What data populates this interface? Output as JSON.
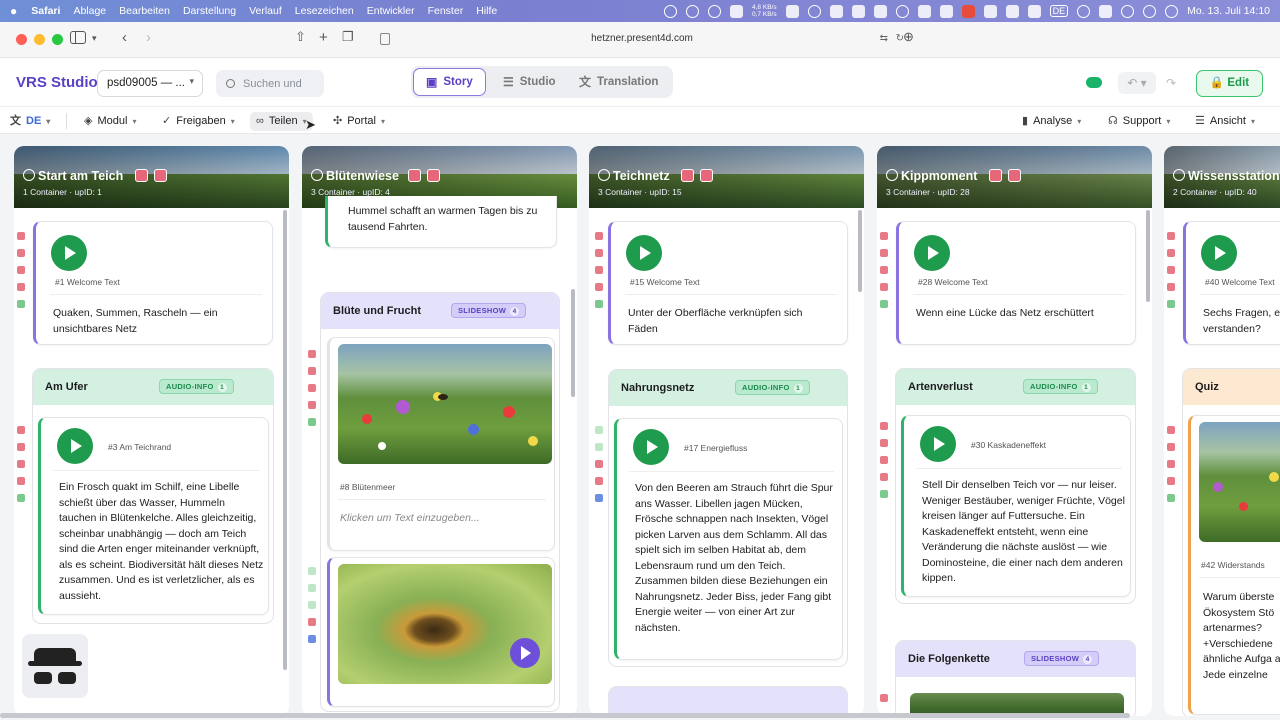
{
  "menubar": {
    "items": [
      "Safari",
      "Ablage",
      "Bearbeiten",
      "Darstellung",
      "Verlauf",
      "Lesezeichen",
      "Entwickler",
      "Fenster",
      "Hilfe"
    ],
    "net_up": "4,8 KB/s",
    "net_down": "0,7 KB/s",
    "lang": "DE",
    "datetime": "Mo. 13. Juli 14:10"
  },
  "browser": {
    "url": "hetzner.present4d.com"
  },
  "app": {
    "brand": "VRS Studio",
    "project": "psd09005 — ...",
    "search_placeholder": "Suchen und",
    "modes": [
      {
        "label": "Story",
        "icon": "map-icon"
      },
      {
        "label": "Studio",
        "icon": "sliders-icon"
      },
      {
        "label": "Translation",
        "icon": "translate-icon"
      }
    ],
    "edit": "Edit"
  },
  "toolbar": {
    "lang": "DE",
    "modul": "Modul",
    "freigaben": "Freigaben",
    "teilen": "Teilen",
    "portal": "Portal",
    "analyse": "Analyse",
    "support": "Support",
    "ansicht": "Ansicht"
  },
  "columns": [
    {
      "title": "Start am Teich",
      "sub": "1 Container · upID: 1",
      "welcome": {
        "meta": "#1  Welcome Text",
        "text": "Quaken, Summen, Rascheln — ein unsichtbares Netz"
      },
      "group": {
        "title": "Am Ufer",
        "badge": "AUDIO-INFO",
        "count": "1",
        "card": {
          "meta": "#3  Am Teichrand",
          "text": "Ein Frosch quakt im Schilf, eine Libelle schießt über das Wasser, Hummeln tauchen in Blütenkelche. Alles gleichzeitig, scheinbar unabhängig — doch am Teich sind die Arten enger miteinander verknüpft, als es scheint. Biodiversität hält dieses Netz zusammen. Und es ist verletzlicher, als es aussieht."
        }
      }
    },
    {
      "title": "Blütenwiese",
      "sub": "3 Container · upID: 4",
      "top_text": "Hummel schafft an warmen Tagen bis zu tausend Fahrten.",
      "group": {
        "title": "Blüte und Frucht",
        "badge": "SLIDESHOW",
        "count": "4",
        "card": {
          "meta": "#8  Blütenmeer",
          "placeholder": "Klicken um Text einzugeben..."
        }
      }
    },
    {
      "title": "Teichnetz",
      "sub": "3 Container · upID: 15",
      "welcome": {
        "meta": "#15  Welcome Text",
        "text": "Unter der Oberfläche verknüpfen sich Fäden"
      },
      "group": {
        "title": "Nahrungsnetz",
        "badge": "AUDIO-INFO",
        "count": "1",
        "card": {
          "meta": "#17  Energiefluss",
          "text": "Von den Beeren am Strauch führt die Spur ans Wasser. Libellen jagen Mücken, Frösche schnappen nach Insekten, Vögel picken Larven aus dem Schlamm. All das spielt sich im selben Habitat ab, dem Lebensraum rund um den Teich. Zusammen bilden diese Beziehungen ein Nahrungsnetz. Jeder Biss, jeder Fang gibt Energie weiter — von einer Art zur nächsten."
        }
      }
    },
    {
      "title": "Kippmoment",
      "sub": "3 Container · upID: 28",
      "welcome": {
        "meta": "#28  Welcome Text",
        "text": "Wenn eine Lücke das Netz erschüttert"
      },
      "group": {
        "title": "Artenverlust",
        "badge": "AUDIO-INFO",
        "count": "1",
        "card": {
          "meta": "#30  Kaskadeneffekt",
          "text": "Stell Dir denselben Teich vor — nur leiser. Weniger Bestäuber, weniger Früchte, Vögel kreisen länger auf Futtersuche. Ein Kaskadeneffekt entsteht, wenn eine Veränderung die nächste auslöst — wie Dominosteine, die einer nach dem anderen kippen."
        }
      },
      "group2": {
        "title": "Die Folgenkette",
        "badge": "SLIDESHOW",
        "count": "4"
      }
    },
    {
      "title": "Wissensstation",
      "sub": "2 Container · upID: 40",
      "welcome": {
        "meta": "#40  Welcome Text",
        "text": "Sechs Fragen, e verstanden?"
      },
      "group": {
        "title": "Quiz",
        "card": {
          "meta": "#42  Widerstands",
          "text": "Warum überste Ökosystem Stö artenarmes? +Verschiedene ähnliche Aufga ab -Jede einzelne"
        }
      }
    }
  ]
}
